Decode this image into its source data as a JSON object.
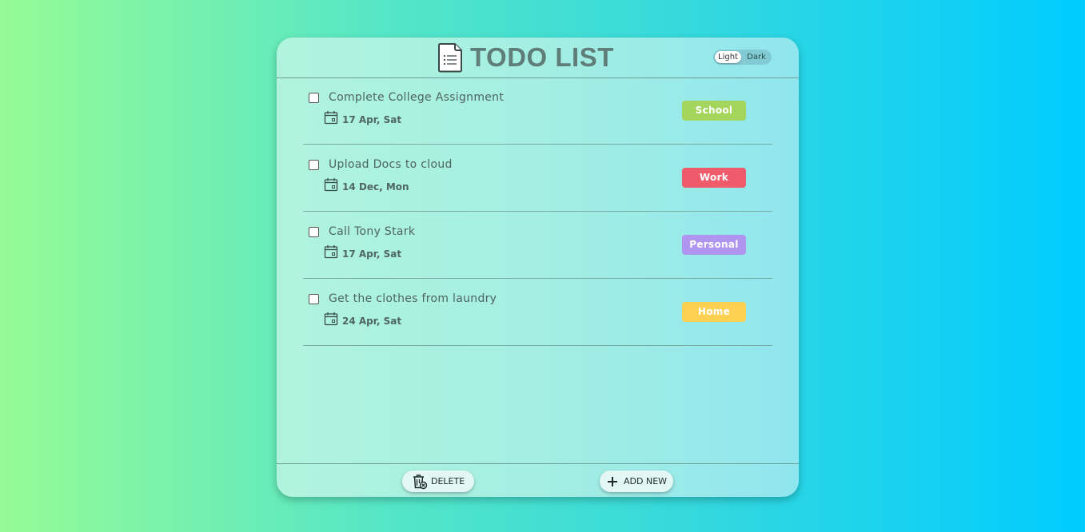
{
  "header": {
    "title": "TODO LIST",
    "title_icon": "document-list-icon",
    "theme_toggle": {
      "light_label": "Light",
      "dark_label": "Dark",
      "selected": "Light"
    }
  },
  "tasks": [
    {
      "title": "Complete College Assignment",
      "date": "17 Apr, Sat",
      "tag": "School",
      "tag_color": "#a4d65e",
      "checked": false
    },
    {
      "title": "Upload Docs to cloud",
      "date": "14 Dec, Mon",
      "tag": "Work",
      "tag_color": "#ef5b6b",
      "checked": false
    },
    {
      "title": "Call Tony Stark",
      "date": "17 Apr, Sat",
      "tag": "Personal",
      "tag_color": "#b095f0",
      "checked": false
    },
    {
      "title": "Get the clothes from laundry",
      "date": "24 Apr, Sat",
      "tag": "Home",
      "tag_color": "#ffd152",
      "checked": false
    }
  ],
  "footer": {
    "delete_label": "DELETE",
    "delete_icon": "trash-bin-icon",
    "add_label": "ADD NEW",
    "add_icon": "plus-icon"
  },
  "colors": {
    "background_start": "#96fb96",
    "background_end": "#00ccff",
    "title_text": "#5f7d79"
  }
}
